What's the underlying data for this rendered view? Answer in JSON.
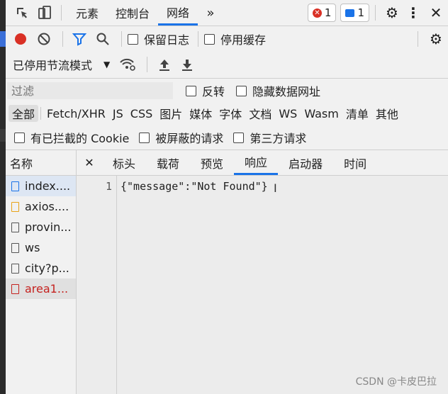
{
  "toolbar": {
    "tabs": [
      "元素",
      "控制台",
      "网络"
    ],
    "active_tab": "网络",
    "error_count": "1",
    "message_count": "1"
  },
  "network": {
    "preserve_log": "保留日志",
    "disable_cache": "停用缓存",
    "throttling": "已停用节流模式",
    "filter_placeholder": "过滤",
    "invert": "反转",
    "hide_data_urls": "隐藏数据网址",
    "types": [
      "全部",
      "Fetch/XHR",
      "JS",
      "CSS",
      "图片",
      "媒体",
      "字体",
      "文档",
      "WS",
      "Wasm",
      "清单",
      "其他"
    ],
    "blocked_cookies": "有已拦截的 Cookie",
    "blocked_requests": "被屏蔽的请求",
    "third_party": "第三方请求"
  },
  "requests": {
    "header": "名称",
    "items": [
      "index....",
      "axios....",
      "provin...",
      "ws",
      "city?p...",
      "area1..."
    ]
  },
  "details": {
    "tabs": [
      "标头",
      "载荷",
      "预览",
      "响应",
      "启动器",
      "时间"
    ],
    "active": "响应",
    "line_number": "1",
    "response_text": "{\"message\":\"Not Found\"}"
  },
  "watermark": "CSDN @卡皮巴拉"
}
